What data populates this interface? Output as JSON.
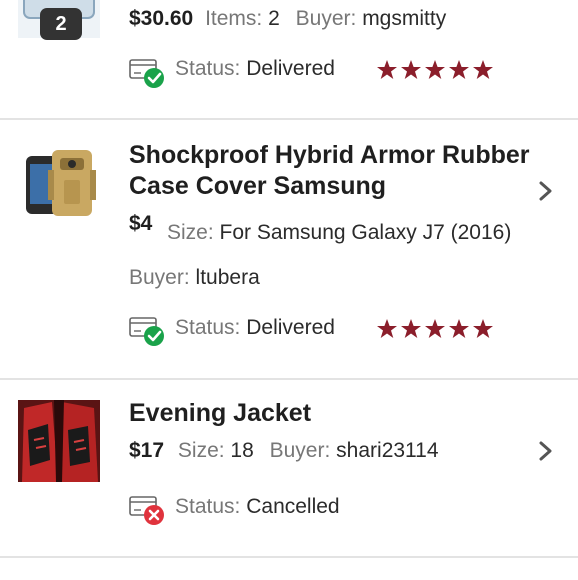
{
  "orders": [
    {
      "price": "$30.60",
      "items_label": "Items:",
      "items_value": "2",
      "buyer_label": "Buyer:",
      "buyer_value": "mgsmitty",
      "badge_count": "2",
      "status_label": "Status:",
      "status_value": "Delivered",
      "status_icon": "delivered-check-icon",
      "rating_stars": 5
    },
    {
      "title_line1": "Shockproof Hybrid Armor Rubber",
      "title_line2": "Case Cover Samsung",
      "price": "$4",
      "size_label": "Size:",
      "size_value": "For Samsung Galaxy J7 (2016)",
      "buyer_label": "Buyer:",
      "buyer_value": "ltubera",
      "status_label": "Status:",
      "status_value": "Delivered",
      "status_icon": "delivered-check-icon",
      "rating_stars": 5
    },
    {
      "title": "Evening Jacket",
      "price": "$17",
      "size_label": "Size:",
      "size_value": "18",
      "buyer_label": "Buyer:",
      "buyer_value": "shari23114",
      "status_label": "Status:",
      "status_value": "Cancelled",
      "status_icon": "cancelled-x-icon"
    }
  ],
  "colors": {
    "star": "#8b1e2b",
    "delivered": "#1aa24a",
    "cancelled": "#e0333d",
    "divider": "#e3e3e3",
    "label": "#777777"
  }
}
